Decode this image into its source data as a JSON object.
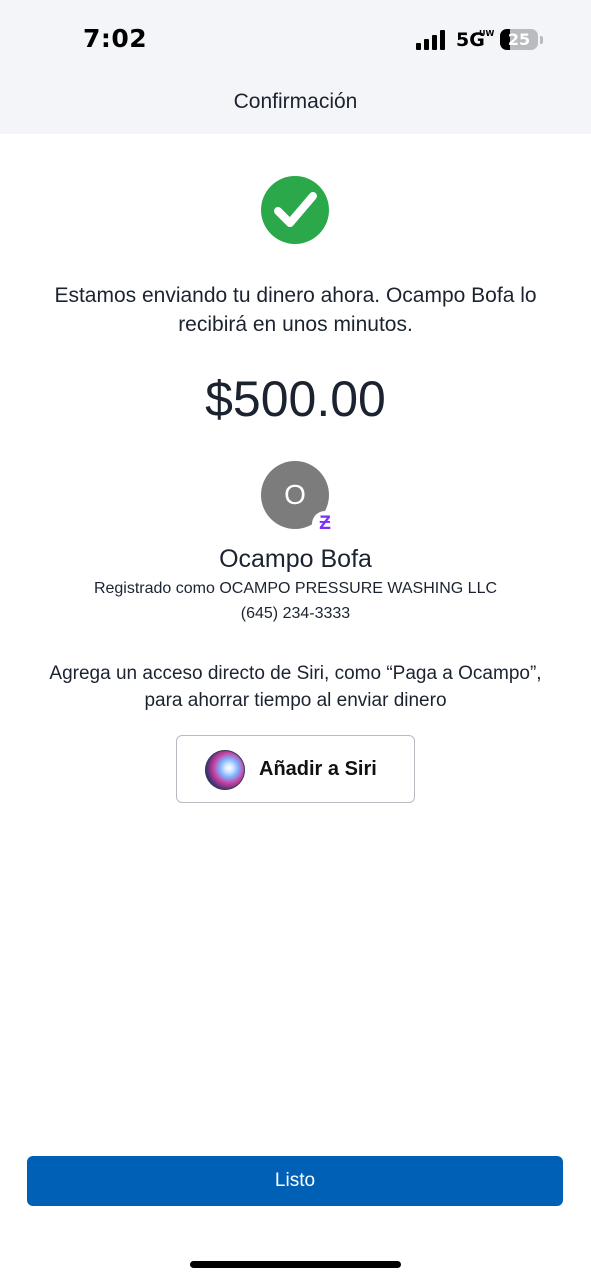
{
  "status_bar": {
    "time": "7:02",
    "network": "5G",
    "network_sub": "UW",
    "battery": "25",
    "battery_level_percent": 25
  },
  "header": {
    "title": "Confirmación"
  },
  "confirmation": {
    "icon": "checkmark-circle-icon",
    "accent_color": "#2aa84a",
    "message": "Estamos enviando tu dinero ahora. Ocampo Bofa lo recibirá en unos minutos.",
    "amount": "$500.00"
  },
  "recipient": {
    "avatar_initial": "O",
    "badge_symbol": "Ƶ",
    "badge_color": "#7b2ff7",
    "name": "Ocampo Bofa",
    "registered_as": "Registrado como OCAMPO PRESSURE WASHING LLC",
    "phone": "(645) 234-3333"
  },
  "siri": {
    "hint": "Agrega un acceso directo de Siri, como “Paga a Ocampo”, para ahorrar tiempo al enviar dinero",
    "button_label": "Añadir a Siri",
    "icon": "siri-icon"
  },
  "footer": {
    "done_label": "Listo",
    "button_color": "#0060b6"
  }
}
